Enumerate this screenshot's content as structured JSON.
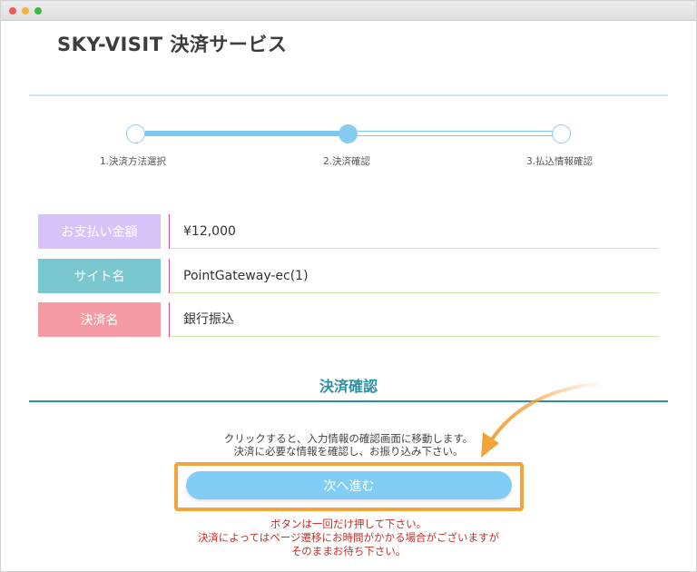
{
  "header": {
    "title": "SKY-VISIT 決済サービス"
  },
  "steps": [
    {
      "label": "1.決済方法選択"
    },
    {
      "label": "2.決済確認"
    },
    {
      "label": "3.払込情報確認"
    }
  ],
  "info": [
    {
      "label": "お支払い金額",
      "value": "¥12,000"
    },
    {
      "label": "サイト名",
      "value": "PointGateway-ec(1)"
    },
    {
      "label": "決済名",
      "value": "銀行振込"
    }
  ],
  "section": {
    "heading": "決済確認"
  },
  "instructions": [
    "クリックすると、入力情報の確認画面に移動します。",
    "決済に必要な情報を確認し、お振り込み下さい。"
  ],
  "button": {
    "label": "次へ進む"
  },
  "warnings": [
    "ボタンは一回だけ押して下さい。",
    "決済によってはページ遷移にお時間がかかる場合がございますが",
    "そのままお待ち下さい。"
  ],
  "colors": {
    "accent": "#82cdf6",
    "highlight": "#f2a33a",
    "warning": "#c0302a",
    "label_amount": "#d8c3f8",
    "label_site": "#7bc7cf",
    "label_method": "#f59ba5"
  }
}
